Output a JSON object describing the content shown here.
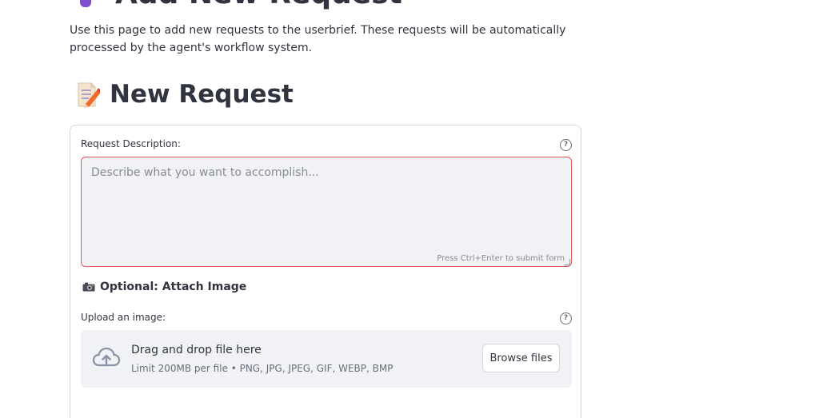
{
  "page": {
    "heading": "Add New Request",
    "intro": "Use this page to add new requests to the userbrief. These requests will be automatically processed by the agent's workflow system."
  },
  "section": {
    "title": "New Request",
    "icon": "memo-icon"
  },
  "form": {
    "description_label": "Request Description:",
    "description_placeholder": "Describe what you want to accomplish...",
    "description_value": "",
    "submit_hint": "Press Ctrl+Enter to submit form",
    "help_glyph": "?",
    "optional_title": "Optional: Attach Image",
    "optional_icon": "camera-icon",
    "upload_label": "Upload an image:",
    "dropzone": {
      "title": "Drag and drop file here",
      "limit": "Limit 200MB per file • PNG, JPG, JPEG, GIF, WEBP, BMP",
      "browse_label": "Browse files",
      "icon": "cloud-upload-icon"
    }
  },
  "colors": {
    "accent_error_border": "#e0565b",
    "field_bg": "#f0f2f6",
    "text": "#31333f",
    "muted_text": "#8a8c94"
  }
}
